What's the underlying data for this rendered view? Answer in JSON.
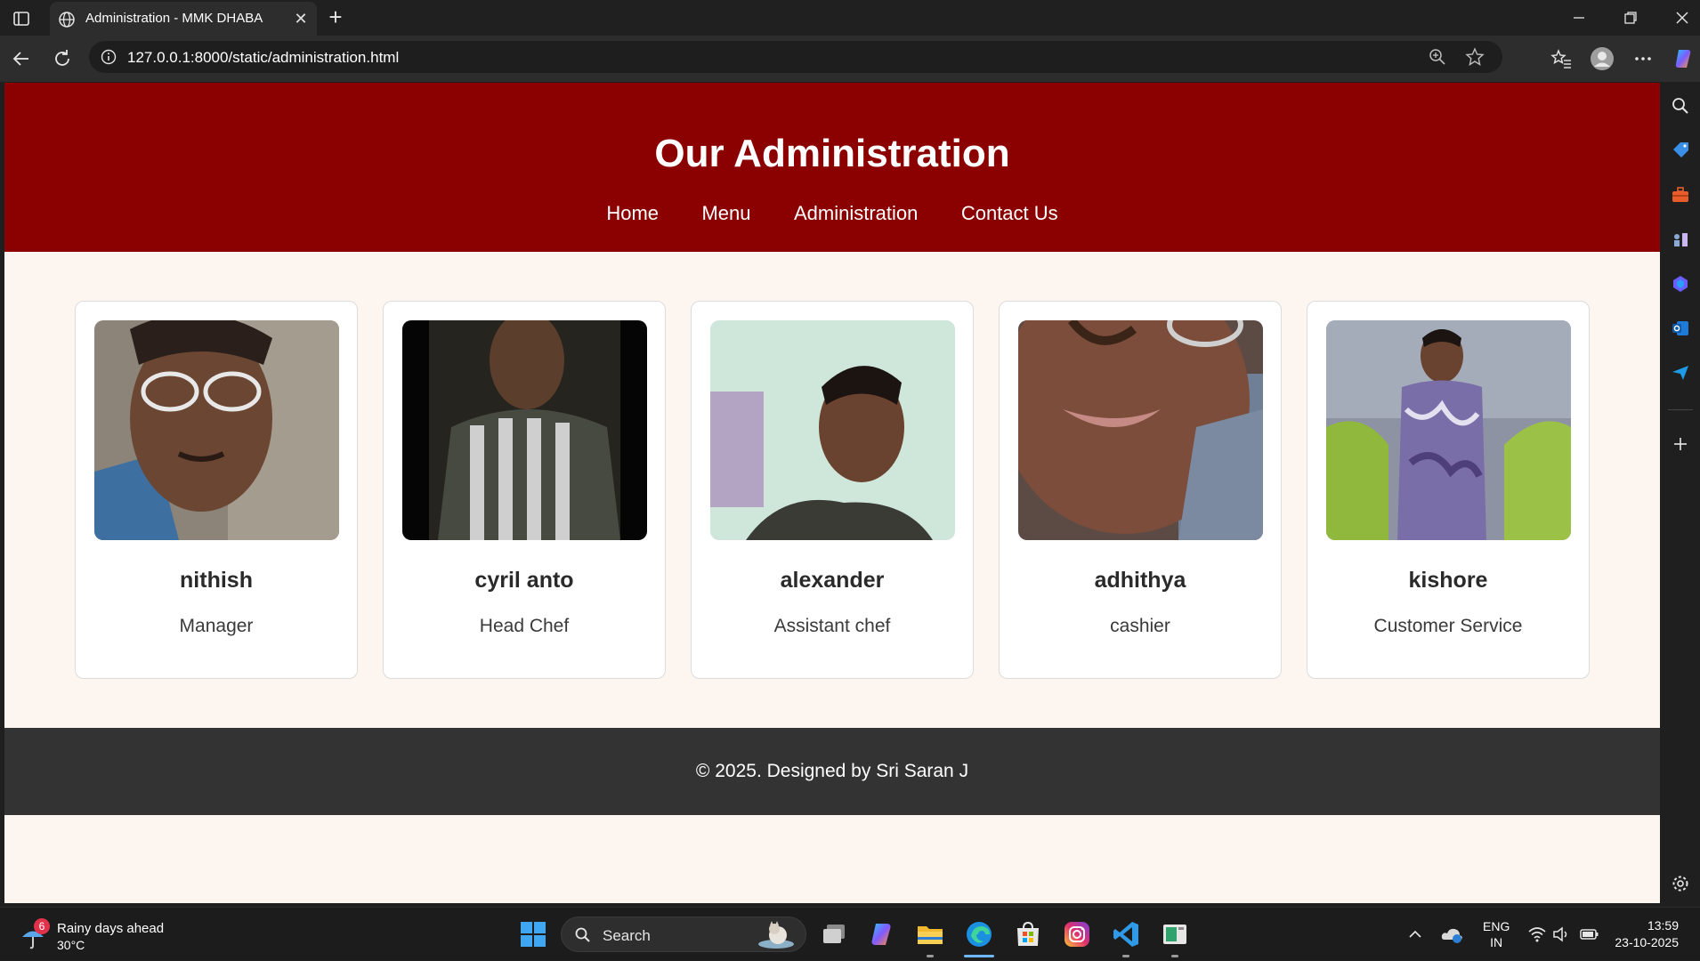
{
  "browser": {
    "tab_title": "Administration - MMK DHABA",
    "url": "127.0.0.1:8000/static/administration.html",
    "new_tab_label": "+",
    "close_tab_label": "✕"
  },
  "site": {
    "title": "Our Administration",
    "nav": [
      "Home",
      "Menu",
      "Administration",
      "Contact Us"
    ],
    "footer": "© 2025. Designed by Sri Saran J",
    "colors": {
      "header": "#8b0000",
      "body": "#fdf5f0",
      "footer": "#333333"
    }
  },
  "team": [
    {
      "name": "nithish",
      "role": "Manager"
    },
    {
      "name": "cyril anto",
      "role": "Head Chef"
    },
    {
      "name": "alexander",
      "role": "Assistant chef"
    },
    {
      "name": "adhithya",
      "role": "cashier"
    },
    {
      "name": "kishore",
      "role": "Customer Service"
    }
  ],
  "taskbar": {
    "weather_badge": "6",
    "weather_line1": "Rainy days ahead",
    "weather_line2": "30°C",
    "search_label": "Search",
    "lang_top": "ENG",
    "lang_bottom": "IN",
    "time": "13:59",
    "date": "23-10-2025"
  }
}
